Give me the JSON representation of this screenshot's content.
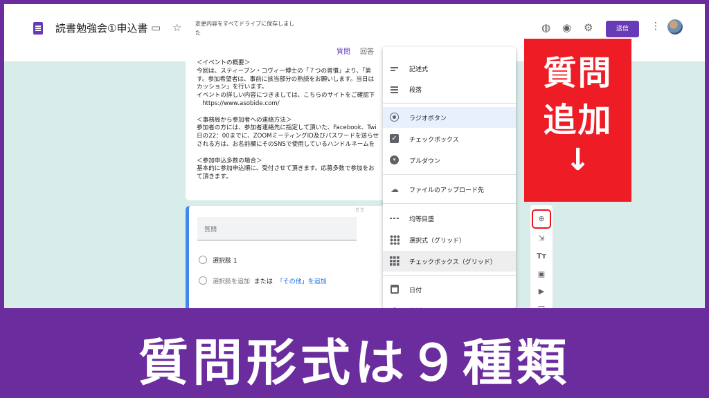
{
  "header": {
    "doc_title": "読書勉強会①申込書",
    "save_status": "変更内容をすべてドライブに保存しました",
    "send_label": "送信"
  },
  "tabs": {
    "questions": "質問",
    "responses": "回答"
  },
  "description": {
    "text": "＜イベントの概要＞\n今回は、スティーブン・コヴィー博士の「７つの習慣」より、「第\nす。参加希望者は、事前に該当部分の熟読をお願いします。当日は\nカッション」を行います。\nイベントの詳しい内容につきましては、こちらのサイトをご確認下\n   https://www.asobide.com/\n\n＜事務局から参加者への連絡方法＞\n参加者の方には、参加者連絡先に指定して頂いた、Facebook、Twi\n日の22：00までに、ZOOMミーティングID及びパスワードを送らせ\nされる方は、お名前欄にそのSNSで使用しているハンドルネームを\n\n＜参加申込多数の場合＞\n基本的に参加申込順に、受付させて頂きます。応募多数で参加をお\nて頂きます。"
  },
  "question_card": {
    "placeholder": "質問",
    "option1": "選択肢 1",
    "add_option": "選択肢を追加",
    "or": "または",
    "add_other": "「その他」を追加"
  },
  "type_menu": {
    "items": [
      {
        "label": "記述式",
        "icon": "short-answer-icon"
      },
      {
        "label": "段落",
        "icon": "paragraph-icon"
      },
      {
        "label": "ラジオボタン",
        "icon": "radio-icon",
        "selected": true
      },
      {
        "label": "チェックボックス",
        "icon": "checkbox-icon"
      },
      {
        "label": "プルダウン",
        "icon": "dropdown-icon"
      },
      {
        "label": "ファイルのアップロード先",
        "icon": "upload-icon"
      },
      {
        "label": "均等目盛",
        "icon": "linear-scale-icon"
      },
      {
        "label": "選択式（グリッド）",
        "icon": "radio-grid-icon"
      },
      {
        "label": "チェックボックス（グリッド）",
        "icon": "checkbox-grid-icon",
        "hovered": true
      },
      {
        "label": "日付",
        "icon": "date-icon"
      },
      {
        "label": "時刻",
        "icon": "time-icon"
      }
    ]
  },
  "callout": {
    "line1": "質問",
    "line2": "追加",
    "arrow": "↓"
  },
  "banner": {
    "text": "質問形式は９種類"
  },
  "colors": {
    "accent": "#673ab7",
    "callout": "#ee1c25",
    "banner": "#6b2d9e"
  }
}
